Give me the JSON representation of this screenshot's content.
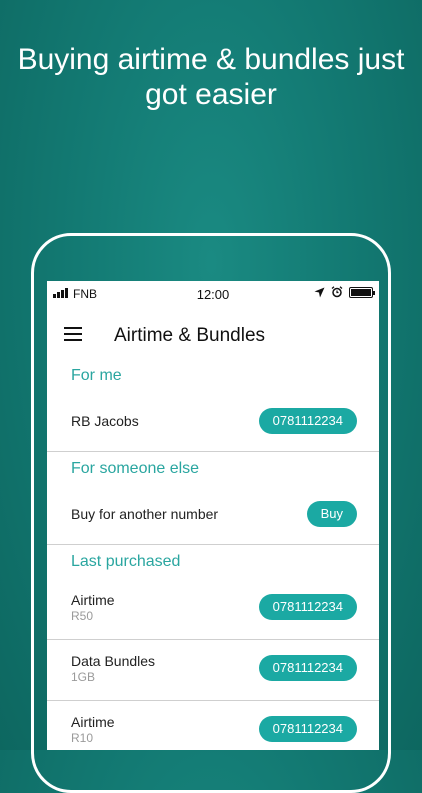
{
  "headline": "Buying airtime & bundles just got easier",
  "status_bar": {
    "carrier": "FNB",
    "time": "12:00"
  },
  "app_bar": {
    "title": "Airtime & Bundles"
  },
  "for_me": {
    "header": "For me",
    "name": "RB Jacobs",
    "number": "0781112234"
  },
  "for_someone_else": {
    "header": "For someone else",
    "label": "Buy for another number",
    "button": "Buy"
  },
  "last_purchased": {
    "header": "Last purchased",
    "items": [
      {
        "title": "Airtime",
        "amount": "R50",
        "number": "0781112234"
      },
      {
        "title": "Data Bundles",
        "amount": "1GB",
        "number": "0781112234"
      },
      {
        "title": "Airtime",
        "amount": "R10",
        "number": "0781112234"
      }
    ]
  },
  "colors": {
    "accent": "#1ba9a3",
    "background": "#137a73"
  }
}
